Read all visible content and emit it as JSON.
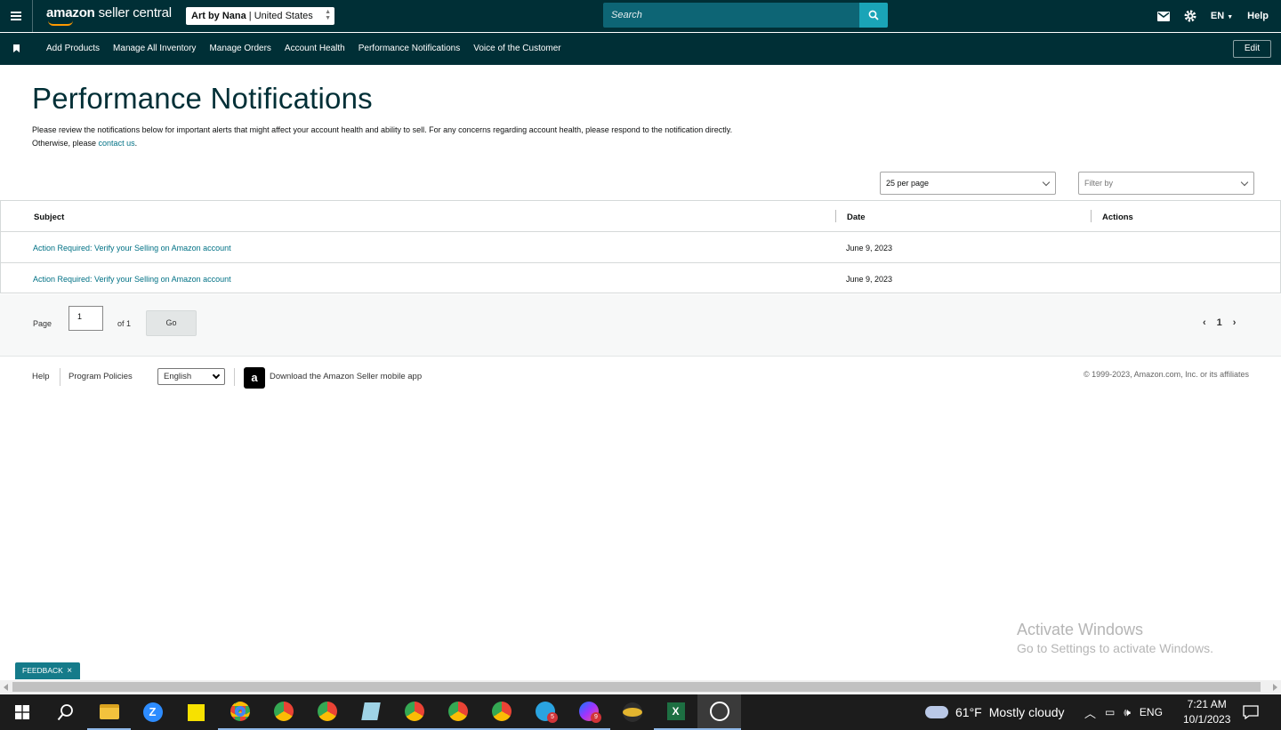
{
  "topbar": {
    "logo_prefix": "amazon",
    "logo_suffix": " seller central",
    "store_name": "Art by Nana",
    "store_region": "United States",
    "search_placeholder": "Search",
    "language": "EN",
    "help": "Help"
  },
  "nav": {
    "items": [
      "Add Products",
      "Manage All Inventory",
      "Manage Orders",
      "Account Health",
      "Performance Notifications",
      "Voice of the Customer"
    ],
    "edit_label": "Edit"
  },
  "page": {
    "title": "Performance Notifications",
    "description_line1": "Please review the notifications below for important alerts that might affect your account health and ability to sell. For any concerns regarding account health, please respond to the notification directly.",
    "description_line2_prefix": "Otherwise, please ",
    "contact_link": "contact us",
    "description_line2_suffix": "."
  },
  "controls": {
    "per_page": "25 per page",
    "filter_placeholder": "Filter by"
  },
  "table": {
    "headers": {
      "subject": "Subject",
      "date": "Date",
      "actions": "Actions"
    },
    "rows": [
      {
        "subject": "Action Required: Verify your Selling on Amazon account",
        "date": "June 9, 2023"
      },
      {
        "subject": "Action Required: Verify your Selling on Amazon account",
        "date": "June 9, 2023"
      }
    ]
  },
  "pager": {
    "page_label": "Page",
    "page_value": "1",
    "of_label": "of 1",
    "go_label": "Go",
    "current_page": "1"
  },
  "footer": {
    "help": "Help",
    "program_policies": "Program Policies",
    "language": "English",
    "app_badge": "a",
    "download_text": "Download the Amazon Seller mobile app",
    "copyright": "© 1999-2023, Amazon.com, Inc. or its affiliates"
  },
  "watermark": {
    "line1": "Activate Windows",
    "line2": "Go to Settings to activate Windows."
  },
  "feedback": {
    "label": "FEEDBACK",
    "close": "×"
  },
  "taskbar": {
    "badges": {
      "telegram": "5",
      "messenger": "9"
    },
    "weather": "61°F",
    "weather_desc": "Mostly cloudy",
    "keyboard": "ENG",
    "time": "7:21 AM",
    "date": "10/1/2023"
  },
  "colors": {
    "header_bg": "#002f36",
    "search_bg": "#0d6575",
    "search_button": "#1aa4b7",
    "link": "#007185",
    "feedback_bg": "#157b8a"
  }
}
